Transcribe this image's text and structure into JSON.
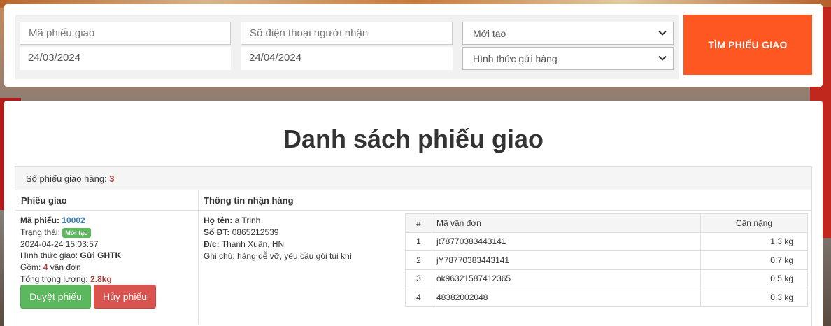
{
  "search": {
    "code_placeholder": "Mã phiếu giao",
    "phone_placeholder": "Số điện thoại người nhận",
    "date_from": "24/03/2024",
    "date_to": "24/04/2024",
    "status_selected": "Mới tạo",
    "method_selected": "Hình thức gửi hàng",
    "submit_label": "TÌM PHIẾU GIAO"
  },
  "list": {
    "title": "Danh sách phiếu giao",
    "count_label": "Số phiếu giao hàng:",
    "count_value": "3",
    "col_delivery": "Phiếu giao",
    "col_receiver": "Thông tin nhận hàng"
  },
  "delivery": {
    "code_label": "Mã phiếu:",
    "code": "10002",
    "status_label": "Trạng thái:",
    "status": "Mới tạo",
    "datetime": "2024-04-24 15:03:57",
    "method_label": "Hình thức giao:",
    "method": "Gửi GHTK",
    "includes_label": "Gồm:",
    "includes_count": "4",
    "includes_unit": "vận đơn",
    "weight_label": "Tổng trọng lượng:",
    "weight": "2.8kg",
    "approve_label": "Duyệt phiếu",
    "cancel_label": "Hủy phiếu"
  },
  "receiver": {
    "name_label": "Họ tên:",
    "name": "a Trinh",
    "phone_label": "Số ĐT:",
    "phone": "0865212539",
    "address_label": "Đ/c:",
    "address": "Thanh Xuân, HN",
    "note_label": "Ghi chú:",
    "note": "hàng dễ vỡ, yêu cầu gói túi khí"
  },
  "waybills": {
    "headers": [
      "#",
      "Mã vận đơn",
      "Cân nặng"
    ],
    "rows": [
      {
        "num": "1",
        "code": "jt78770383443141",
        "weight": "1.3 kg"
      },
      {
        "num": "2",
        "code": "jY78770383443141",
        "weight": "0.7 kg"
      },
      {
        "num": "3",
        "code": "ok96321587412365",
        "weight": "0.5 kg"
      },
      {
        "num": "4",
        "code": "48382002048",
        "weight": "0.3 kg"
      }
    ]
  },
  "colors": {
    "accent": "#ff5722",
    "success": "#5cb85c",
    "danger": "#d9534f",
    "link": "#337ab7"
  }
}
